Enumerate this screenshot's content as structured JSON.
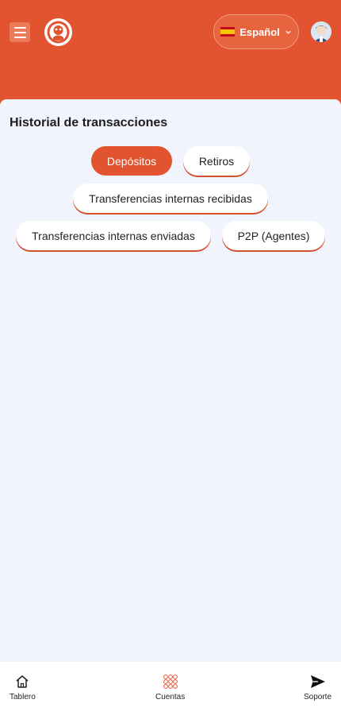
{
  "header": {
    "language_label": "Español",
    "icons": {
      "menu": "hamburger-icon",
      "logo": "brand-logo",
      "flag": "spain-flag-icon",
      "chevron": "chevron-down-icon",
      "avatar": "user-avatar"
    }
  },
  "main": {
    "title": "Historial de transacciones",
    "tabs": [
      {
        "label": "Depósitos",
        "active": true
      },
      {
        "label": "Retiros",
        "active": false
      },
      {
        "label": "Transferencias internas recibidas",
        "active": false
      },
      {
        "label": "Transferencias internas enviadas",
        "active": false
      },
      {
        "label": "P2P (Agentes)",
        "active": false
      }
    ]
  },
  "bottom_nav": {
    "items": [
      {
        "label": "Tablero",
        "icon": "home-icon"
      },
      {
        "label": "Cuentas",
        "icon": "grid-icon"
      },
      {
        "label": "Soporte",
        "icon": "send-icon"
      }
    ]
  },
  "colors": {
    "accent": "#e1542f",
    "background": "#f1f3fd",
    "text": "#222222"
  }
}
